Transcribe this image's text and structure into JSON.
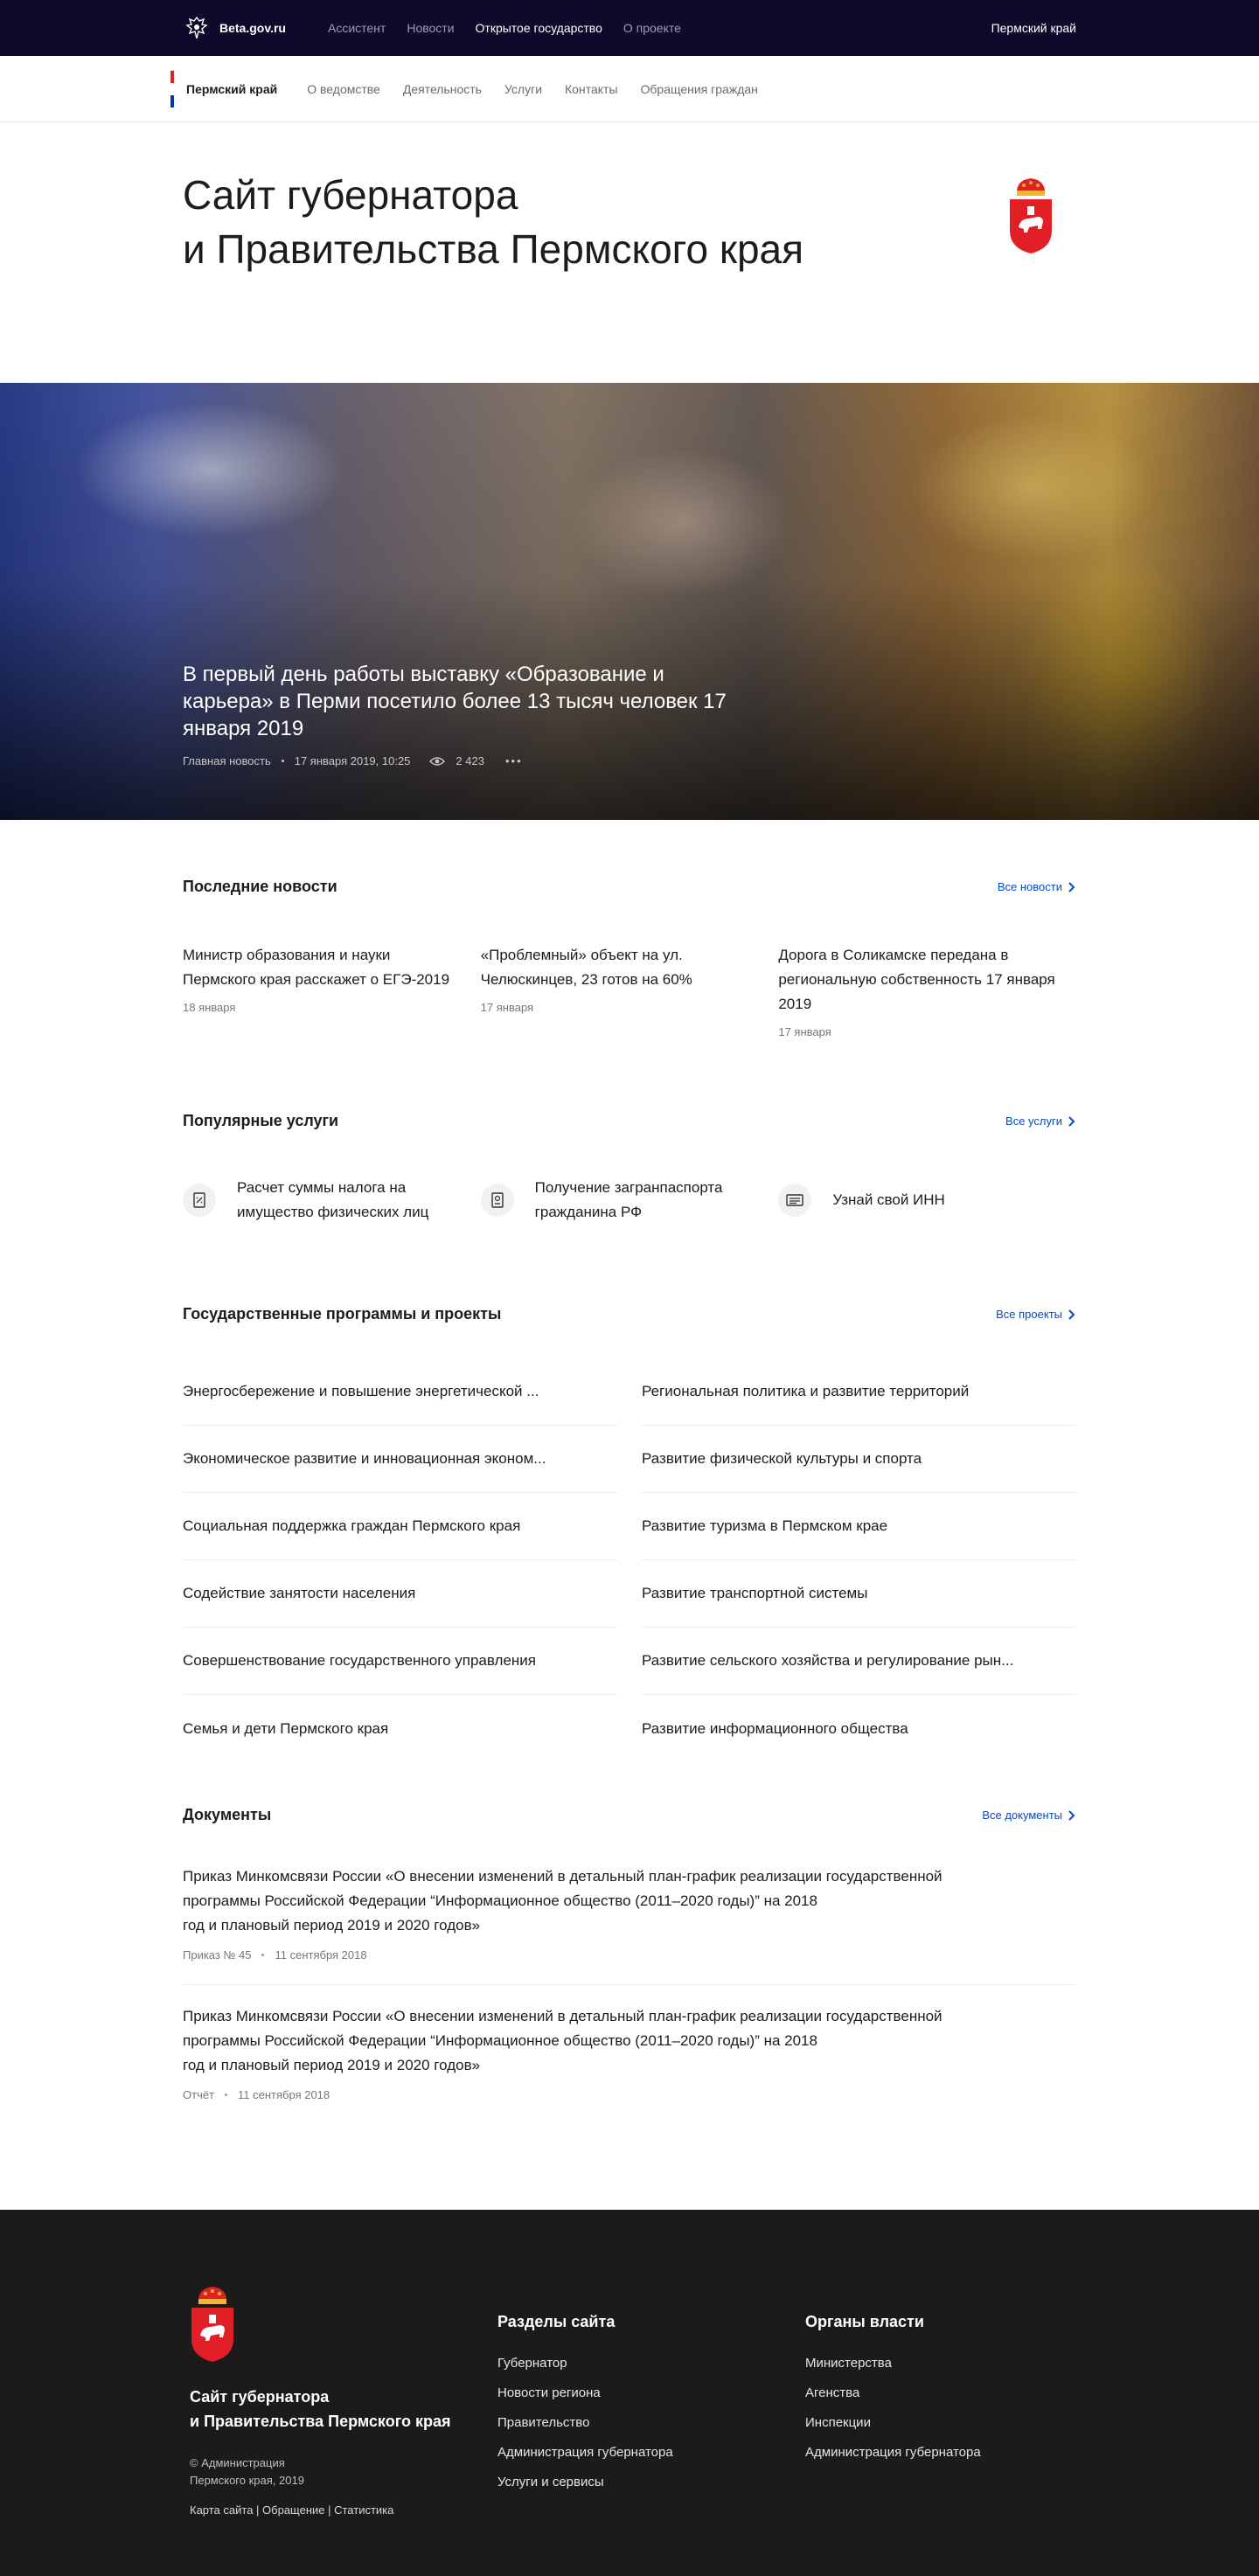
{
  "topbar": {
    "brand": "Beta.gov.ru",
    "nav": [
      "Ассистент",
      "Новости",
      "Открытое государство",
      "О проекте"
    ],
    "active_index": 2,
    "region": "Пермский край"
  },
  "subnav": {
    "region": "Пермский край",
    "links": [
      "О ведомстве",
      "Деятельность",
      "Услуги",
      "Контакты",
      "Обращения граждан"
    ]
  },
  "header": {
    "title_line1": "Сайт губернатора",
    "title_line2": "и Правительства Пермского края"
  },
  "hero": {
    "title": "В первый день работы выставку «Образование и карьера» в Перми посетило более 13 тысяч человек 17 января 2019",
    "category": "Главная новость",
    "date": "17 января 2019, 10:25",
    "views": "2 423",
    "more": "•••"
  },
  "news": {
    "title": "Последние новости",
    "all_label": "Все новости",
    "items": [
      {
        "title": "Министр образования и науки Пермского края расскажет о ЕГЭ-2019",
        "date": "18 января"
      },
      {
        "title": "«Проблемный» объект на ул. Челюскинцев, 23 готов на 60%",
        "date": "17 января"
      },
      {
        "title": "Дорога в Соликамске передана в региональную собственность 17 января 2019",
        "date": "17 января"
      }
    ]
  },
  "services": {
    "title": "Популярные услуги",
    "all_label": "Все услуги",
    "items": [
      {
        "title": "Расчет суммы налога на имущество физических лиц",
        "icon": "calculator-icon"
      },
      {
        "title": "Получение загранпаспорта гражданина РФ",
        "icon": "passport-icon"
      },
      {
        "title": "Узнай свой ИНН",
        "icon": "id-card-icon"
      }
    ]
  },
  "programs": {
    "title": "Государственные программы и проекты",
    "all_label": "Все проекты",
    "left": [
      "Энергосбережение и повышение энергетической ...",
      "Экономическое развитие и инновационная эконом...",
      "Социальная поддержка граждан Пермского края",
      "Содействие занятости населения",
      "Совершенствование государственного управления",
      "Семья и дети Пермского края"
    ],
    "right": [
      "Региональная политика и развитие территорий",
      "Развитие физической культуры и спорта",
      "Развитие туризма в Пермском крае",
      "Развитие транспортной системы",
      "Развитие сельского хозяйства и регулирование рын...",
      "Развитие информационного общества"
    ]
  },
  "documents": {
    "title": "Документы",
    "all_label": "Все документы",
    "items": [
      {
        "line1": "Приказ Минкомсвязи России «О внесении изменений в детальный план-график реализации государственной",
        "line2": "программы Российской Федерации “Информационное общество (2011–2020 годы)” на 2018",
        "line3": "год и плановый период 2019 и 2020 годов»",
        "type": "Приказ № 45",
        "date": "11 сентября 2018"
      },
      {
        "line1": "Приказ Минкомсвязи России «О внесении изменений в детальный план-график реализации государственной",
        "line2": "программы Российской Федерации “Информационное общество (2011–2020 годы)” на 2018",
        "line3": "год и плановый период 2019 и 2020 годов»",
        "type": "Отчёт",
        "date": "11 сентября 2018"
      }
    ]
  },
  "footer": {
    "title_line1": "Сайт губернатора",
    "title_line2": "и Правительства Пермского края",
    "copy_line1": "© Администрация",
    "copy_line2": "Пермского края, 2019",
    "links": "Карта сайта | Обращение | Статистика",
    "sections": {
      "title": "Разделы сайта",
      "items": [
        "Губернатор",
        "Новости региона",
        "Правительство",
        "Администрация губернатора",
        "Услуги и сервисы"
      ]
    },
    "authorities": {
      "title": "Органы власти",
      "items": [
        "Министерства",
        "Агенства",
        "Инспекции",
        "Администрация губернатора"
      ]
    }
  },
  "colors": {
    "topbar_bg": "#0d0a2c",
    "link_blue": "#0a4ac2",
    "footer_bg": "#1b1b1b",
    "flag": [
      "#ffffff",
      "#0039a6",
      "#d52b1e"
    ],
    "coat_red": "#e11f26"
  }
}
